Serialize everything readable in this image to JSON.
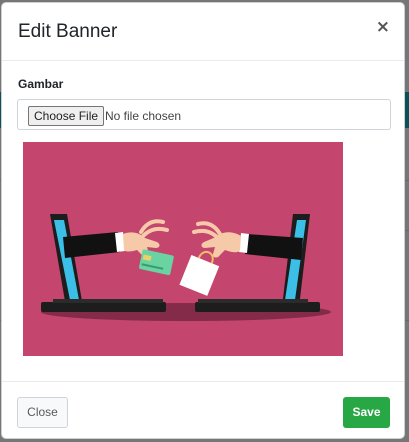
{
  "modal": {
    "title": "Edit Banner",
    "close_symbol": "×"
  },
  "form": {
    "image_label": "Gambar",
    "file_button_label": "Choose File",
    "file_status": "No file chosen"
  },
  "preview": {
    "description_icon": "banner-illustration",
    "background_color": "#c4456d"
  },
  "footer": {
    "close_label": "Close",
    "save_label": "Save"
  },
  "colors": {
    "save": "#28a745",
    "accent": "#17a2b8"
  }
}
